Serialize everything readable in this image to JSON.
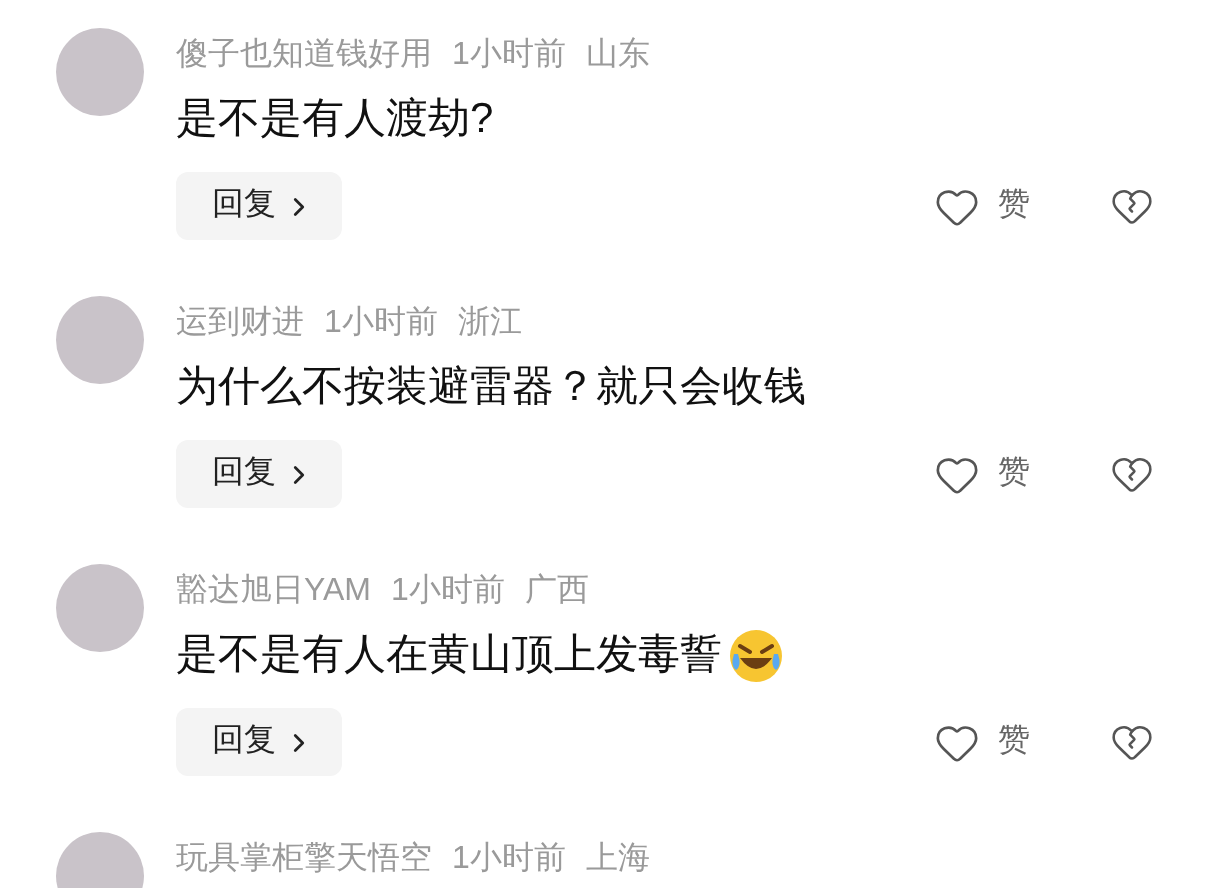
{
  "comments": [
    {
      "username": "傻子也知道钱好用",
      "time": "1小时前",
      "location": "山东",
      "text": "是不是有人渡劫?",
      "reply_label": "回复",
      "like_label": "赞"
    },
    {
      "username": "运到财进",
      "time": "1小时前",
      "location": "浙江",
      "text": "为什么不按装避雷器？就只会收钱",
      "reply_label": "回复",
      "like_label": "赞"
    },
    {
      "username": "豁达旭日YAM",
      "time": "1小时前",
      "location": "广西",
      "text": "是不是有人在黄山顶上发毒誓",
      "emoji": true,
      "reply_label": "回复",
      "like_label": "赞"
    },
    {
      "username": "玩具掌柜擎天悟空",
      "time": "1小时前",
      "location": "上海"
    }
  ]
}
